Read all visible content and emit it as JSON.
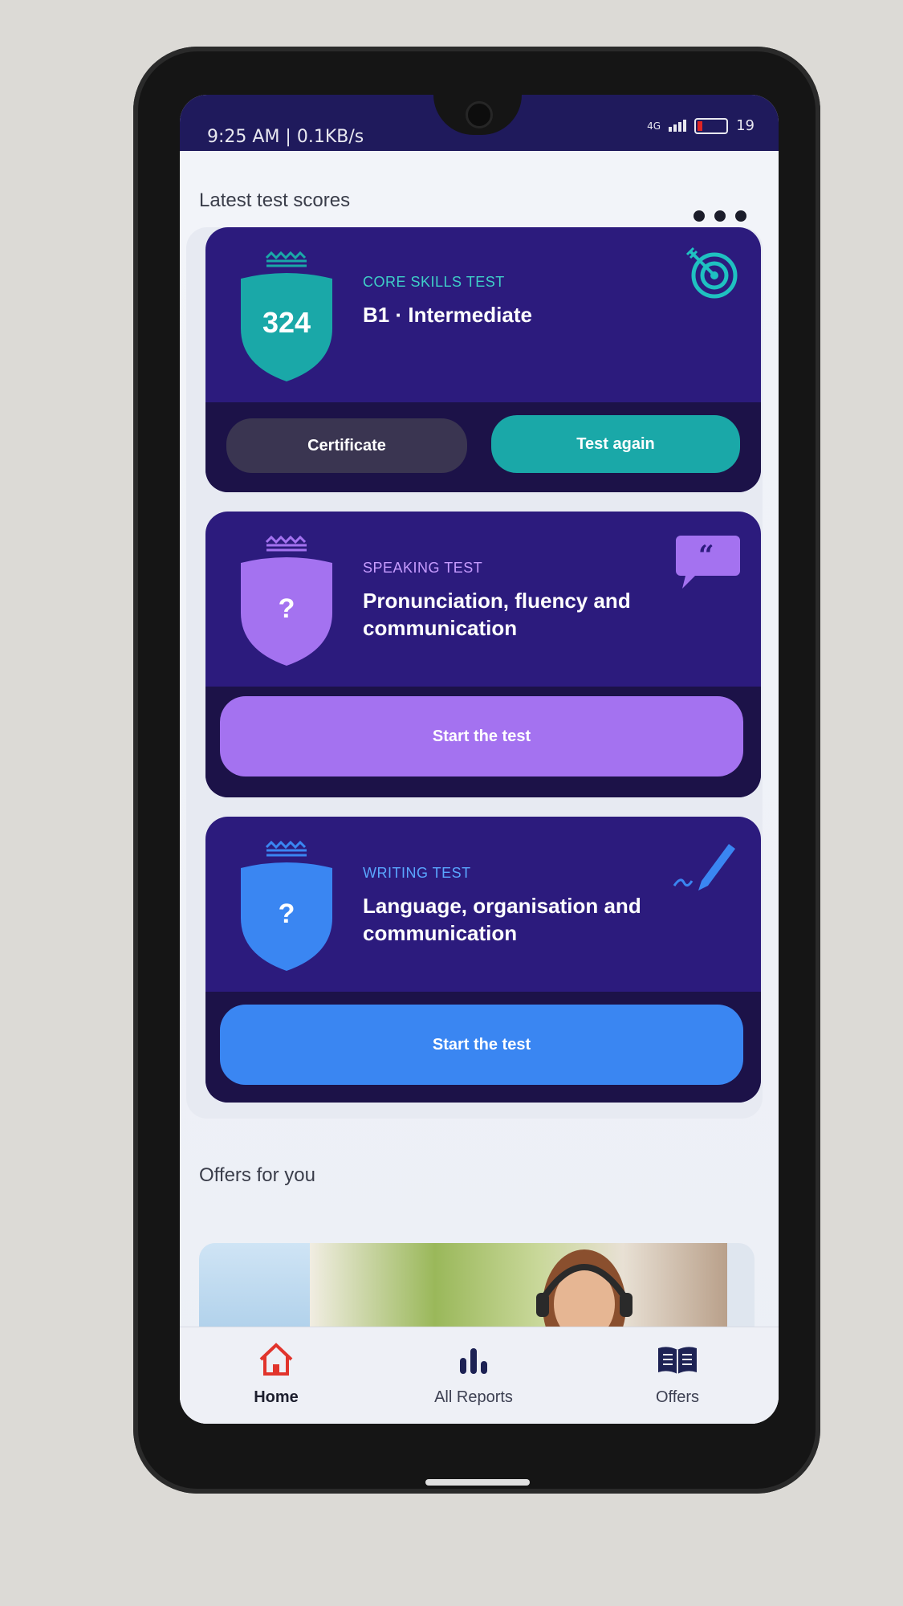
{
  "status_bar": {
    "left": "9:25 AM | 0.1KB/s",
    "network": "4G",
    "battery": "19"
  },
  "header": {
    "title": "Latest test scores"
  },
  "cards": [
    {
      "category": "CORE SKILLS TEST",
      "title": "B1 · Intermediate",
      "score": "324",
      "left_button": "Certificate",
      "right_button": "Test again"
    },
    {
      "category": "SPEAKING TEST",
      "title": "Pronunciation, fluency and communication",
      "score": "?",
      "button": "Start the test"
    },
    {
      "category": "WRITING TEST",
      "title": "Language, organisation and communication",
      "score": "?",
      "button": "Start the test"
    }
  ],
  "offers": {
    "title": "Offers for you"
  },
  "nav": [
    {
      "label": "Home"
    },
    {
      "label": "All Reports"
    },
    {
      "label": "Offers"
    }
  ],
  "colors": {
    "card_bg": "#2c1b7d",
    "teal": "#1aa8a8",
    "purple": "#a472f0",
    "blue": "#3a86f2",
    "home_red": "#e1342c"
  }
}
